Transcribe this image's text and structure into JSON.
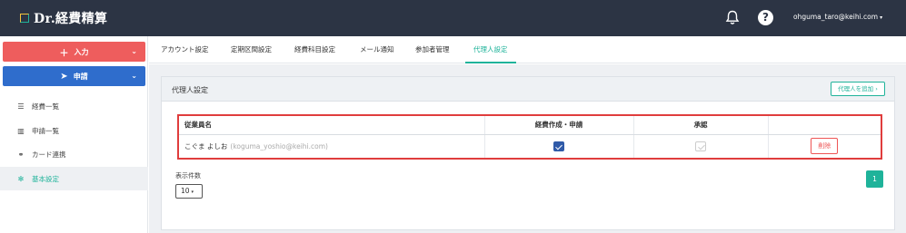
{
  "header": {
    "logo_text": "Dr.経費精算",
    "bell_icon": "bell-icon",
    "help_icon": "question-circle-icon",
    "help_glyph": "?",
    "user_email": "ohguma_taro@keihi.com",
    "user_caret": "▾"
  },
  "sidebar": {
    "input_button": {
      "icon": "＋",
      "label": "入力",
      "chevron": "⌄"
    },
    "apply_button": {
      "icon": "➤",
      "label": "申請",
      "chevron": "⌄"
    },
    "items": [
      {
        "icon": "list-icon",
        "glyph": "☰",
        "label": "経費一覧"
      },
      {
        "icon": "bar-chart-icon",
        "glyph": "▥",
        "label": "申請一覧"
      },
      {
        "icon": "link-icon",
        "glyph": "⚭",
        "label": "カード連携"
      },
      {
        "icon": "gear-icon",
        "glyph": "✻",
        "label": "基本設定"
      }
    ]
  },
  "tabs": [
    {
      "label": "アカウント設定"
    },
    {
      "label": "定期区間設定"
    },
    {
      "label": "経費科目設定"
    },
    {
      "label": "メール通知"
    },
    {
      "label": "参加者管理"
    },
    {
      "label": "代理人設定"
    }
  ],
  "panel": {
    "title": "代理人設定",
    "add_button": "代理人を追加",
    "add_button_arrow": "›",
    "table": {
      "headers": [
        "従業員名",
        "経費作成・申請",
        "承認",
        ""
      ],
      "rows": [
        {
          "name": "こぐま よしお",
          "email": "(koguma_yoshio@keihi.com)",
          "create_apply": true,
          "approve": false,
          "delete_label": "削除"
        }
      ]
    },
    "count_label": "表示件数",
    "count_value": "10",
    "count_caret": "▾",
    "current_page": "1"
  },
  "colors": {
    "topbar": "#2c3444",
    "accent": "#1fb39a",
    "input_button": "#ee5d5d",
    "apply_button": "#2f6dcc",
    "highlight_border": "#e03d3d"
  }
}
